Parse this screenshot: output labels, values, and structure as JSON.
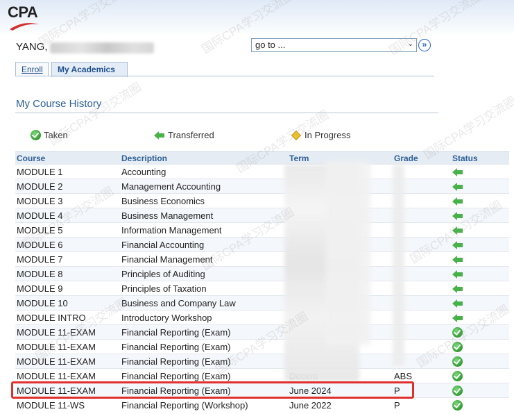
{
  "header": {
    "logo_text": "CPA",
    "user_name": "YANG, ",
    "goto_select": {
      "selected": "go to ...",
      "arrow": "⌄",
      "go_button": "»"
    }
  },
  "tabs": [
    {
      "label": "Enroll",
      "active": false
    },
    {
      "label": "My Academics",
      "active": true
    }
  ],
  "section_title": "My Course History",
  "legend": {
    "taken": "Taken",
    "transferred": "Transferred",
    "in_progress": "In Progress"
  },
  "table": {
    "columns": [
      "Course",
      "Description",
      "Term",
      "Grade",
      "Status"
    ],
    "rows": [
      {
        "course": "MODULE 1",
        "description": "Accounting",
        "term": "",
        "grade": "",
        "status": "transferred"
      },
      {
        "course": "MODULE 2",
        "description": "Management Accounting",
        "term": "",
        "grade": "",
        "status": "transferred"
      },
      {
        "course": "MODULE 3",
        "description": "Business Economics",
        "term": "",
        "grade": "",
        "status": "transferred"
      },
      {
        "course": "MODULE 4",
        "description": "Business Management",
        "term": "",
        "grade": "",
        "status": "transferred"
      },
      {
        "course": "MODULE 5",
        "description": "Information Management",
        "term": "",
        "grade": "",
        "status": "transferred"
      },
      {
        "course": "MODULE 6",
        "description": "Financial Accounting",
        "term": "",
        "grade": "",
        "status": "transferred"
      },
      {
        "course": "MODULE 7",
        "description": "Financial Management",
        "term": "",
        "grade": "",
        "status": "transferred"
      },
      {
        "course": "MODULE 8",
        "description": "Principles of Auditing",
        "term": "",
        "grade": "",
        "status": "transferred"
      },
      {
        "course": "MODULE 9",
        "description": "Principles of Taxation",
        "term": "",
        "grade": "",
        "status": "transferred"
      },
      {
        "course": "MODULE 10",
        "description": "Business and Company Law",
        "term": "",
        "grade": "",
        "status": "transferred"
      },
      {
        "course": "MODULE INTRO",
        "description": "Introductory Workshop",
        "term": "",
        "grade": "",
        "status": "transferred"
      },
      {
        "course": "MODULE 11-EXAM",
        "description": "Financial Reporting (Exam)",
        "term": "",
        "grade": "",
        "status": "taken"
      },
      {
        "course": "MODULE 11-EXAM",
        "description": "Financial Reporting (Exam)",
        "term": "",
        "grade": "",
        "status": "taken"
      },
      {
        "course": "MODULE 11-EXAM",
        "description": "Financial Reporting (Exam)",
        "term": "",
        "grade": "",
        "status": "taken"
      },
      {
        "course": "MODULE 11-EXAM",
        "description": "Financial Reporting (Exam)",
        "term": "Decem",
        "grade": "ABS",
        "status": "taken"
      },
      {
        "course": "MODULE 11-EXAM",
        "description": "Financial Reporting (Exam)",
        "term": "June 2024",
        "grade": "P",
        "status": "taken"
      },
      {
        "course": "MODULE 11-WS",
        "description": "Financial Reporting (Workshop)",
        "term": "June 2022",
        "grade": "P",
        "status": "taken"
      }
    ]
  },
  "watermark_text": "国际CPA学习交流圈",
  "colors": {
    "accent_blue": "#2d5f96",
    "highlight_red": "#e0302e",
    "status_green": "#2e9a2e"
  }
}
